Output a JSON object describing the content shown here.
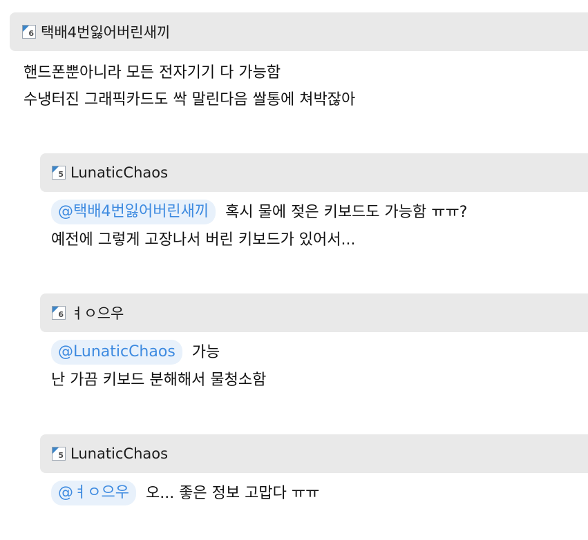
{
  "post": {
    "author": {
      "level": "6",
      "nickname": "택배4번잃어버린새끼"
    },
    "lines": [
      "핸드폰뿐아니라 모든 전자기기 다 가능함",
      "수냉터진 그래픽카드도 싹 말린다음 쌀통에 쳐박잖아"
    ]
  },
  "replies": [
    {
      "author": {
        "level": "5",
        "nickname": "LunaticChaos"
      },
      "mention": "@택배4번잃어버린새끼",
      "first_text": "혹시 물에 젖은 키보드도 가능함 ㅠㅠ?",
      "more_lines": [
        "예전에 그렇게 고장나서 버린 키보드가 있어서..."
      ]
    },
    {
      "author": {
        "level": "6",
        "nickname": "ㅕㅇ으우"
      },
      "mention": "@LunaticChaos",
      "first_text": "가능",
      "more_lines": [
        "난 가끔 키보드 분해해서 물청소함"
      ]
    },
    {
      "author": {
        "level": "5",
        "nickname": "LunaticChaos"
      },
      "mention": "@ㅕㅇ으우",
      "first_text": "오... 좋은 정보 고맙다 ㅠㅠ",
      "more_lines": []
    }
  ]
}
